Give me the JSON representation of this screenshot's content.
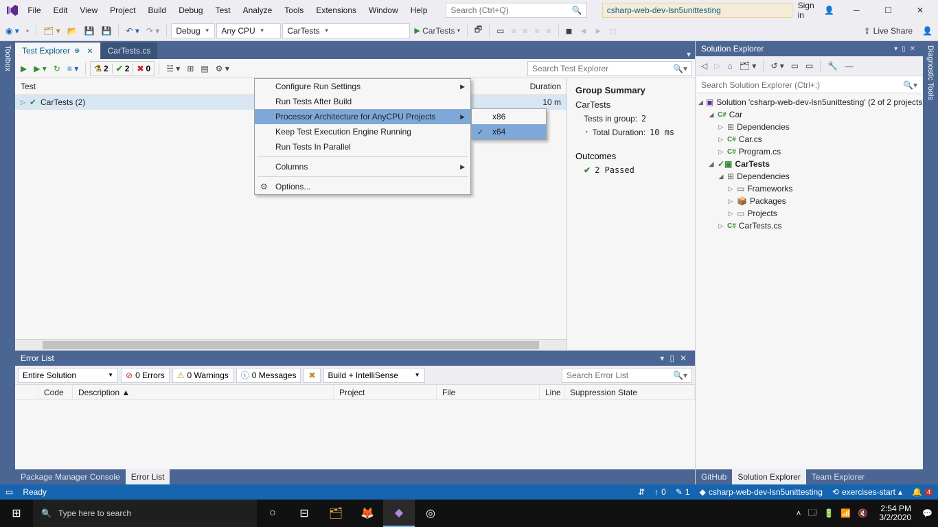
{
  "title": {
    "menu": [
      "File",
      "Edit",
      "View",
      "Project",
      "Build",
      "Debug",
      "Test",
      "Analyze",
      "Tools",
      "Extensions",
      "Window",
      "Help"
    ],
    "search_placeholder": "Search (Ctrl+Q)",
    "solution": "csharp-web-dev-lsn5unittesting",
    "signin": "Sign in"
  },
  "toolbar": {
    "config": "Debug",
    "platform": "Any CPU",
    "project": "CarTests",
    "run": "CarTests",
    "liveshare": "Live Share"
  },
  "left_rail": "Toolbox",
  "right_rail": "Diagnostic Tools",
  "tabs": [
    {
      "label": "Test Explorer",
      "active": true,
      "pinned": true
    },
    {
      "label": "CarTests.cs",
      "active": false
    }
  ],
  "test_explorer": {
    "search_placeholder": "Search Test Explorer",
    "counts": {
      "flask": "2",
      "pass": "2",
      "fail": "0"
    },
    "columns": [
      "Test",
      "Duration"
    ],
    "row": {
      "name": "CarTests  (2)",
      "duration": "10 m"
    },
    "summary": {
      "title": "Group Summary",
      "group": "CarTests",
      "tests_label": "Tests in group:",
      "tests_value": "2",
      "duration_label": "Total Duration:",
      "duration_value": "10 ms",
      "outcomes": "Outcomes",
      "passed": "2 Passed"
    }
  },
  "context_menu": {
    "items": [
      "Configure Run Settings",
      "Run Tests After Build",
      "Processor Architecture for AnyCPU Projects",
      "Keep Test Execution Engine Running",
      "Run Tests In Parallel",
      "Columns",
      "Options..."
    ],
    "submenu": [
      "x86",
      "x64"
    ]
  },
  "error_list": {
    "title": "Error List",
    "scope": "Entire Solution",
    "errors": "0 Errors",
    "warnings": "0 Warnings",
    "messages": "0 Messages",
    "build": "Build + IntelliSense",
    "search_placeholder": "Search Error List",
    "columns": [
      "Code",
      "Description",
      "Project",
      "File",
      "Line",
      "Suppression State"
    ],
    "bottom_tabs": [
      "Package Manager Console",
      "Error List"
    ]
  },
  "solution_explorer": {
    "title": "Solution Explorer",
    "search_placeholder": "Search Solution Explorer (Ctrl+;)",
    "root": "Solution 'csharp-web-dev-lsn5unittesting' (2 of 2 projects)",
    "tree": {
      "car": "Car",
      "deps": "Dependencies",
      "carcs": "Car.cs",
      "program": "Program.cs",
      "cartests": "CarTests",
      "frameworks": "Frameworks",
      "packages": "Packages",
      "projects": "Projects",
      "cartestscs": "CarTests.cs"
    },
    "bottom_tabs": [
      "GitHub",
      "Solution Explorer",
      "Team Explorer"
    ]
  },
  "status": {
    "ready": "Ready",
    "up": "0",
    "pen": "1",
    "repo": "csharp-web-dev-lsn5unittesting",
    "branch": "exercises-start",
    "notif": "4"
  },
  "taskbar": {
    "search": "Type here to search",
    "time": "2:54 PM",
    "date": "3/2/2020"
  }
}
